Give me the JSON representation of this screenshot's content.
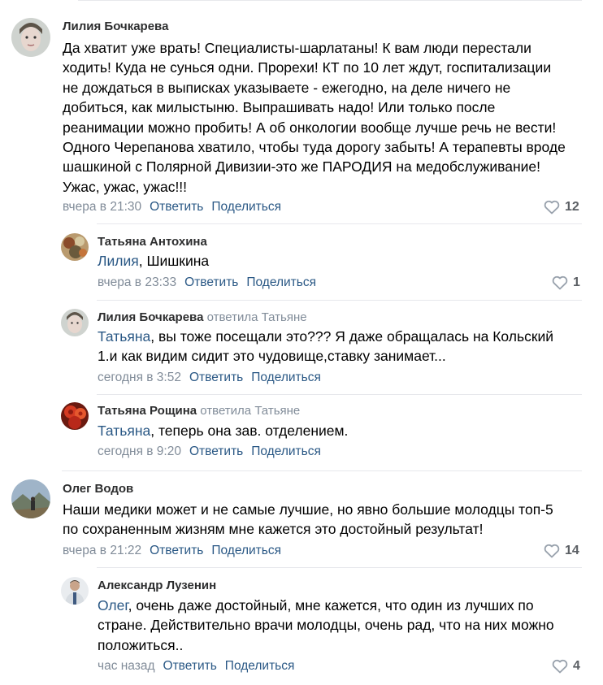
{
  "comments": [
    {
      "name": "Лилия Бочкарева",
      "text_lines": [
        "Да хватит уже врать! Специалисты-шарлатаны! К вам люди перестали",
        "ходить! Куда не сунься одни. Прорехи! КТ по 10 лет ждут, госпитализации",
        "не дождаться в выписках указываете - ежегодно, на деле ничего не",
        "добиться, как милыстыню. Выпрашивать надо! Или только после",
        "реанимации можно пробить! А об онкологии вообще лучше речь не вести!",
        "Одного Черепанова хватило, чтобы туда дорогу забыть! А терапевты вроде",
        "шашкиной с Полярной Дивизии-это же ПАРОДИЯ на медобслуживание!",
        "Ужас, ужас, ужас!!!"
      ],
      "time": "вчера в 21:30",
      "reply": "Ответить",
      "share": "Поделиться",
      "likes": "12"
    },
    {
      "name": "Татьяна Антохина",
      "mention": "Лилия",
      "text_rest": ", Шишкина",
      "time": "вчера в 23:33",
      "reply": "Ответить",
      "share": "Поделиться",
      "likes": "1"
    },
    {
      "name": "Лилия Бочкарева",
      "replied_to": "ответила Татьяне",
      "mention": "Татьяна",
      "text_rest": ", вы тоже посещали это??? Я даже обращалась на Кольский",
      "text_line2": "1.и как видим сидит это чудовище,ставку занимает...",
      "time": "сегодня в 3:52",
      "reply": "Ответить",
      "share": "Поделиться"
    },
    {
      "name": "Татьяна Рощина",
      "replied_to": "ответила Татьяне",
      "mention": "Татьяна",
      "text_rest": ", теперь она зав. отделением.",
      "time": "сегодня в 9:20",
      "reply": "Ответить",
      "share": "Поделиться"
    },
    {
      "name": "Олег Водов",
      "text_lines": [
        "Наши медики может и не самые лучшие, но явно большие молодцы топ-5",
        "по сохраненным жизням мне кажется это достойный результат!"
      ],
      "time": "вчера в 21:22",
      "reply": "Ответить",
      "share": "Поделиться",
      "likes": "14"
    },
    {
      "name": "Александр Лузенин",
      "mention": "Олег",
      "text_rest": ", очень даже достойный, мне кажется, что один из лучших по",
      "text_line2": "стране. Действительно врачи молодцы, очень рад, что на них можно",
      "text_line3": "положиться..",
      "time": "час назад",
      "reply": "Ответить",
      "share": "Поделиться",
      "likes": "4"
    }
  ],
  "colors": {
    "link": "#2a5885",
    "secondary": "#818c99",
    "name": "#2c2d2e",
    "divider": "#e7e8ec"
  }
}
